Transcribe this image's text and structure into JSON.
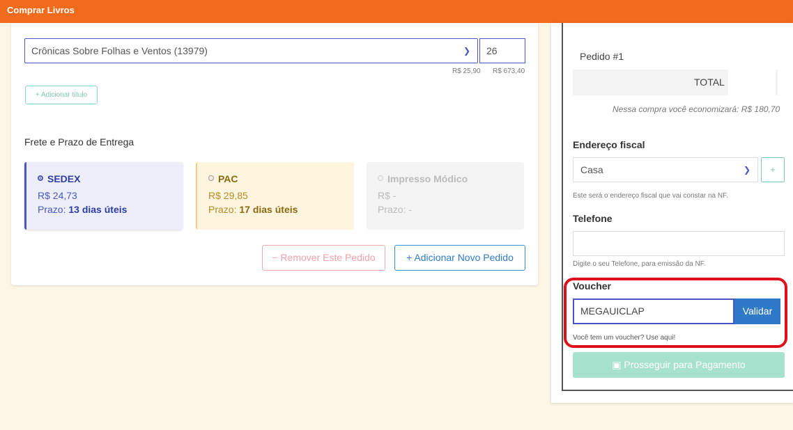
{
  "topbar": {
    "title": "Comprar Livros"
  },
  "order": {
    "book_selected": "Crônicas Sobre Folhas e Ventos (13979)",
    "quantity": "26",
    "unit_price": "R$ 25,90",
    "total_price": "R$ 673,40",
    "add_title_label": "+ Adicionar título",
    "shipping_heading": "Frete e Prazo de Entrega",
    "shipping_options": [
      {
        "name": "SEDEX",
        "price": "R$ 24,73",
        "prazo_label": "Prazo:",
        "prazo_value": "13 dias úteis",
        "selected": true
      },
      {
        "name": "PAC",
        "price": "R$ 29,85",
        "prazo_label": "Prazo:",
        "prazo_value": "17 dias úteis",
        "selected": false
      },
      {
        "name": "Impresso Módico",
        "price": "R$ -",
        "prazo_label": "Prazo:",
        "prazo_value": "-",
        "selected": false,
        "disabled": true
      }
    ],
    "remove_label": "− Remover Este Pedido",
    "add_order_label": "+ Adicionar Novo Pedido"
  },
  "summary": {
    "pedido_label": "Pedido #1",
    "total_label": "TOTAL",
    "economia_text": "Nessa compra você economizará: R$ 180,70",
    "endereco_label": "Endereço fiscal",
    "endereco_selected": "Casa",
    "endereco_add_label": "+",
    "endereco_hint": "Este será o endereço fiscal que vai constar na NF.",
    "telefone_label": "Telefone",
    "telefone_value": "",
    "telefone_hint": "Digite o seu Telefone, para emissão da NF.",
    "voucher_label": "Voucher",
    "voucher_value": "MEGAUICLAP",
    "validar_label": "Validar",
    "voucher_hint": "Você tem um voucher? Use aqui!",
    "prosseguir_label": "Prosseguir para Pagamento"
  },
  "colors": {
    "brand": "#f26a1b",
    "primary": "#4a56c6",
    "button_blue": "#2f7ac8",
    "success_light": "#a7e2cf",
    "highlight": "#e0101a"
  }
}
